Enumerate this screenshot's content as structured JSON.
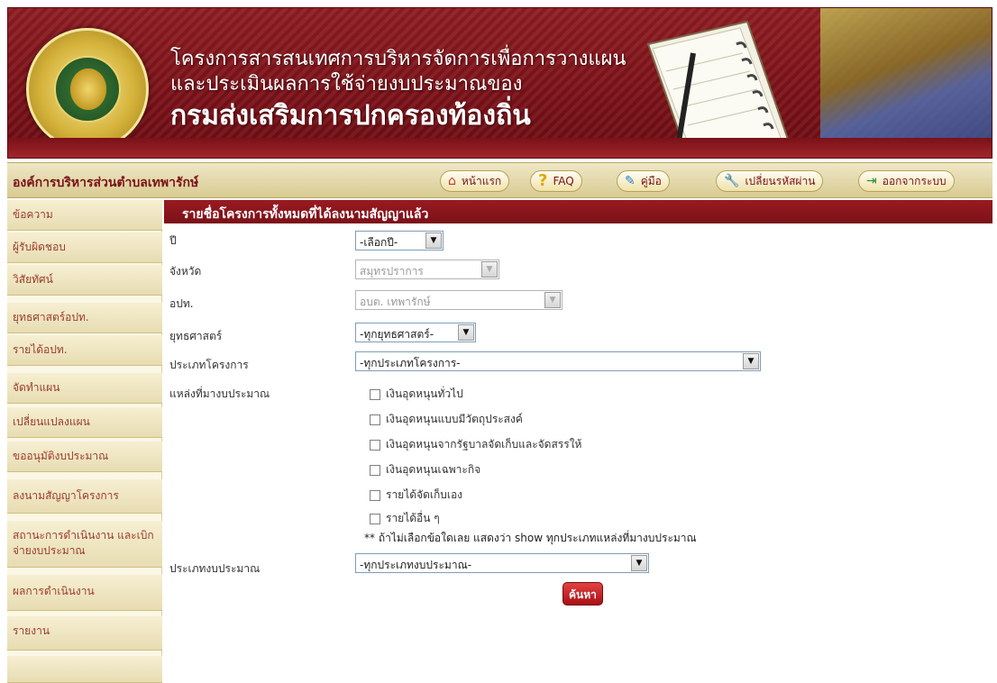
{
  "banner": {
    "title_line1": "โครงการสารสนเทศการบริหารจัดการเพื่อการวางแผน",
    "title_line2": "และประเมินผลการใช้จ่ายงบประมาณของ",
    "title_line3": "กรมส่งเสริมการปกครองท้องถิ่น"
  },
  "navbar": {
    "org_name": "องค์การบริหารส่วนตำบลเทพารักษ์",
    "buttons": [
      {
        "label": "หน้าแรก",
        "icon": "home-icon"
      },
      {
        "label": "FAQ",
        "icon": "question-icon"
      },
      {
        "label": "คู่มือ",
        "icon": "manual-icon"
      },
      {
        "label": "เปลี่ยนรหัสผ่าน",
        "icon": "key-icon"
      },
      {
        "label": "ออกจากระบบ",
        "icon": "exit-icon"
      }
    ]
  },
  "sidebar": {
    "items": [
      {
        "label": "ข้อความ"
      },
      {
        "label": "ผู้รับผิดชอบ"
      },
      {
        "label": "วิสัยทัศน์"
      },
      {
        "label": "ยุทธศาสตร์อปท."
      },
      {
        "label": "รายได้อปท."
      },
      {
        "label": "จัดทำแผน"
      },
      {
        "label": "เปลี่ยนแปลงแผน"
      },
      {
        "label": "ขออนุมัติงบประมาณ"
      },
      {
        "label": "ลงนามสัญญาโครงการ"
      },
      {
        "label": "สถานะการดำเนินงาน และเบิกจ่ายงบประมาณ"
      },
      {
        "label": "ผลการดำเนินงาน"
      },
      {
        "label": "รายงาน"
      }
    ]
  },
  "content": {
    "header": "รายชื่อโครงการทั้งหมดที่ได้ลงนามสัญญาแล้ว",
    "fields": {
      "year": {
        "label": "ปี",
        "value": "-เลือกปี-"
      },
      "province": {
        "label": "จังหวัด",
        "value": "สมุทรปราการ"
      },
      "lao": {
        "label": "อปท.",
        "value": "อบต. เทพารักษ์"
      },
      "strategy": {
        "label": "ยุทธศาสตร์",
        "value": "-ทุกยุทธศาสตร์-"
      },
      "project_type": {
        "label": "ประเภทโครงการ",
        "value": "-ทุกประเภทโครงการ-"
      },
      "budget_source": {
        "label": "แหล่งที่มางบประมาณ"
      },
      "budget_type": {
        "label": "ประเภทงบประมาณ",
        "value": "-ทุกประเภทงบประมาณ-"
      }
    },
    "sources": [
      "เงินอุดหนุนทั่วไป",
      "เงินอุดหนุนแบบมีวัตถุประสงค์",
      "เงินอุดหนุนจากรัฐบาลจัดเก็บและจัดสรรให้",
      "เงินอุดหนุนเฉพาะกิจ",
      "รายได้จัดเก็บเอง",
      "รายได้อื่น ๆ"
    ],
    "note": "** ถ้าไม่เลือกข้อใดเลย แสดงว่า show ทุกประเภทแหล่งที่มางบประมาณ",
    "search_label": "ค้นหา"
  }
}
